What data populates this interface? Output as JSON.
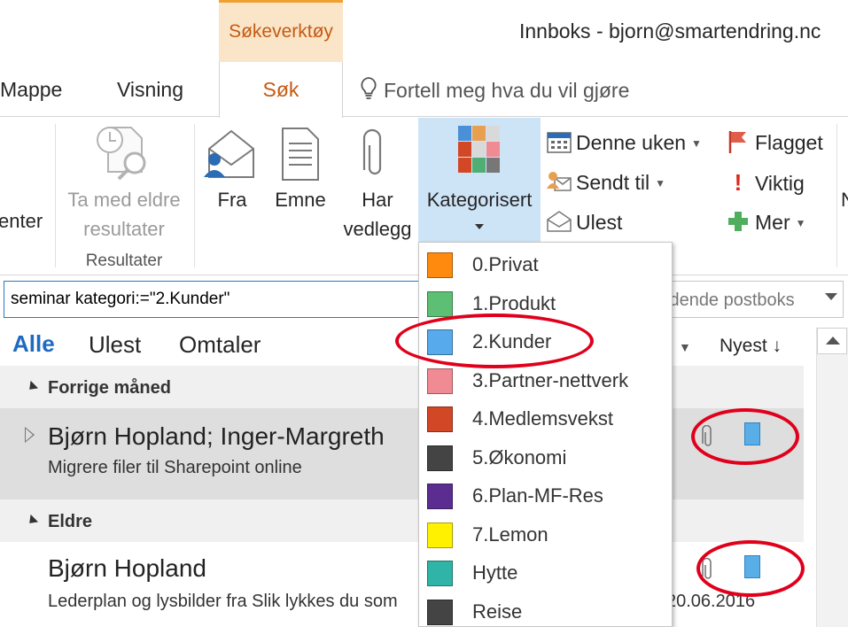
{
  "titlebar": {
    "contextual_tab": "Søkeverktøy",
    "window_title": "Innboks - bjorn@smartendring.nc"
  },
  "tabs": {
    "mappe": "Mappe",
    "visning": "Visning",
    "sok": "Søk",
    "tellme": "Fortell meg hva du vil gjøre"
  },
  "ribbon": {
    "cut_label": "enter",
    "older_results_line1": "Ta med eldre",
    "older_results_line2": "resultater",
    "group_results": "Resultater",
    "fra": "Fra",
    "emne": "Emne",
    "har_line1": "Har",
    "har_line2": "vedlegg",
    "kategorisert": "Kategorisert",
    "denne_uken": "Denne uken",
    "sendt_til": "Sendt til",
    "ulest": "Ulest",
    "flagget": "Flagget",
    "viktig": "Viktig",
    "mer": "Mer",
    "cut_right": "N"
  },
  "search": {
    "value": "seminar kategori:=\"2.Kunder\"",
    "scope": "ldende postboks"
  },
  "filters": {
    "alle": "Alle",
    "ulest": "Ulest",
    "omtaler": "Omtaler",
    "sort": "Nyest ↓"
  },
  "groups": [
    {
      "label": "Forrige måned"
    },
    {
      "label": "Eldre"
    }
  ],
  "mails": [
    {
      "sender": "Bjørn Hopland;  Inger-Margreth",
      "subject": "Migrere filer til Sharepoint online",
      "date": ""
    },
    {
      "sender": "Bjørn Hopland",
      "subject": "Lederplan og lysbilder fra Slik lykkes du som",
      "date": "20.06.2016"
    }
  ],
  "categories": [
    {
      "label": "0.Privat",
      "color": "#ff8a0d"
    },
    {
      "label": "1.Produkt",
      "color": "#5cbf73"
    },
    {
      "label": "2.Kunder",
      "color": "#57aaeb"
    },
    {
      "label": "3.Partner-nettverk",
      "color": "#f08a93"
    },
    {
      "label": "4.Medlemsvekst",
      "color": "#d24726"
    },
    {
      "label": "5.Økonomi",
      "color": "#444444"
    },
    {
      "label": "6.Plan-MF-Res",
      "color": "#5c2d91"
    },
    {
      "label": "7.Lemon",
      "color": "#fff100"
    },
    {
      "label": "Hytte",
      "color": "#30b4a8"
    },
    {
      "label": "Reise",
      "color": "#444444"
    }
  ],
  "colors": {
    "accent": "#c55a11",
    "highlight": "#cde4f7",
    "annotation": "#e0001b"
  }
}
